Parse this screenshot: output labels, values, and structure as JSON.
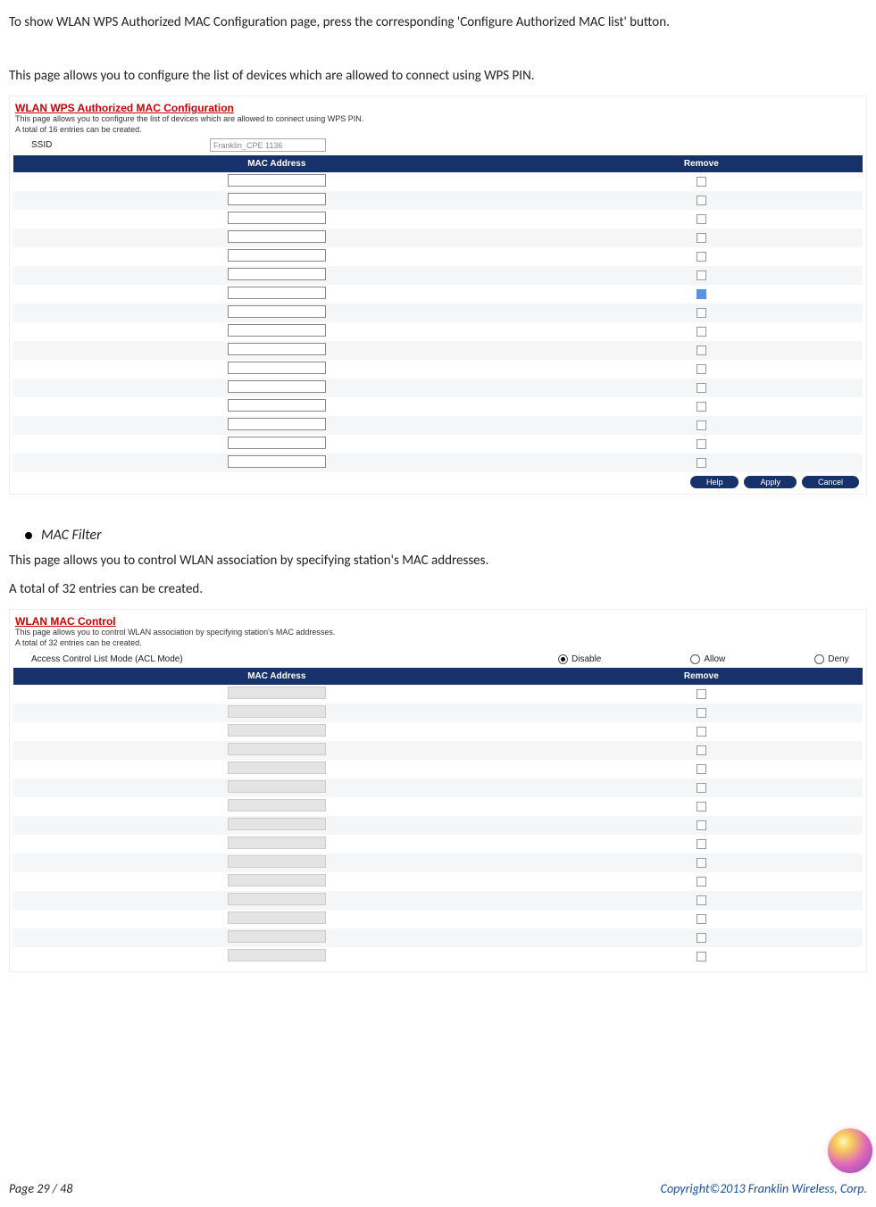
{
  "intro1": "To show WLAN WPS Authorized MAC Configuration page, press the corresponding 'Configure Authorized MAC list' button.",
  "intro2": "This page allows you to configure the list of devices which are allowed to connect using WPS PIN.",
  "panel1": {
    "title": "WLAN WPS Authorized MAC Configuration",
    "desc1": "This page allows you to configure the list of devices which are allowed to connect using WPS PIN.",
    "desc2": "A total of 16 entries can be created.",
    "ssid_label": "SSID",
    "ssid_value": "Franklin_CPE 1136",
    "headers": {
      "mac": "MAC Address",
      "remove": "Remove"
    },
    "rows": [
      {
        "checked": false
      },
      {
        "checked": false
      },
      {
        "checked": false
      },
      {
        "checked": false
      },
      {
        "checked": false
      },
      {
        "checked": false
      },
      {
        "checked": true
      },
      {
        "checked": false
      },
      {
        "checked": false
      },
      {
        "checked": false
      },
      {
        "checked": false
      },
      {
        "checked": false
      },
      {
        "checked": false
      },
      {
        "checked": false
      },
      {
        "checked": false
      },
      {
        "checked": false
      }
    ],
    "buttons": {
      "help": "Help",
      "apply": "Apply",
      "cancel": "Cancel"
    }
  },
  "bullet_heading": "MAC Filter",
  "filter1": "This page allows you to control WLAN association by specifying station's MAC addresses.",
  "filter2": "A total of 32 entries can be created.",
  "panel2": {
    "title": "WLAN MAC Control",
    "desc1": "This page allows you to control WLAN association by specifying station's MAC addresses.",
    "desc2": "A total of 32 entries can be created.",
    "acl_label": "Access Control List Mode (ACL Mode)",
    "acl_options": {
      "disable": "Disable",
      "allow": "Allow",
      "deny": "Deny"
    },
    "acl_selected": "disable",
    "headers": {
      "mac": "MAC Address",
      "remove": "Remove"
    },
    "row_count": 15
  },
  "footer": {
    "page": "Page  29  /  48",
    "copyright": "Copyright©2013  Franklin  Wireless, Corp."
  }
}
